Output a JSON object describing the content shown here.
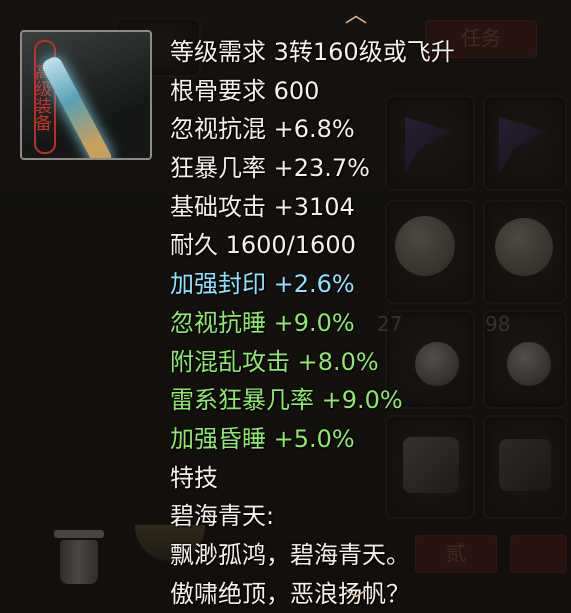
{
  "background": {
    "slot_counts": [
      "27",
      "98"
    ],
    "buttons": [
      "任务",
      "贰"
    ]
  },
  "tooltip": {
    "seal_text": "高级装备",
    "lines": [
      {
        "text": "等级需求 3转160级或飞升",
        "color": "white"
      },
      {
        "text": "根骨要求 600",
        "color": "white"
      },
      {
        "text": "忽视抗混 +6.8%",
        "color": "white"
      },
      {
        "text": "狂暴几率 +23.7%",
        "color": "white"
      },
      {
        "text": "基础攻击 +3104",
        "color": "white"
      },
      {
        "text": "耐久 1600/1600",
        "color": "white"
      },
      {
        "text": "加强封印 +2.6%",
        "color": "cyan"
      },
      {
        "text": "忽视抗睡 +9.0%",
        "color": "green"
      },
      {
        "text": "附混乱攻击 +8.0%",
        "color": "green"
      },
      {
        "text": "雷系狂暴几率 +9.0%",
        "color": "green"
      },
      {
        "text": "加强昏睡 +5.0%",
        "color": "green"
      },
      {
        "text": "特技",
        "color": "white"
      },
      {
        "text": "碧海青天:",
        "color": "white"
      },
      {
        "text": "飘渺孤鸿，碧海青天。",
        "color": "white"
      },
      {
        "text": "傲啸绝顶，恶浪扬帆？",
        "color": "white"
      }
    ]
  },
  "colors": {
    "white": "#f4f0ea",
    "cyan": "#8fe2ff",
    "green": "#8fe86e",
    "seal_red": "#c2372c",
    "arrow": "#e8b48a"
  },
  "icons": [
    "chevron-up-icon",
    "chevron-down-icon",
    "trash-icon",
    "weapon-icon"
  ]
}
